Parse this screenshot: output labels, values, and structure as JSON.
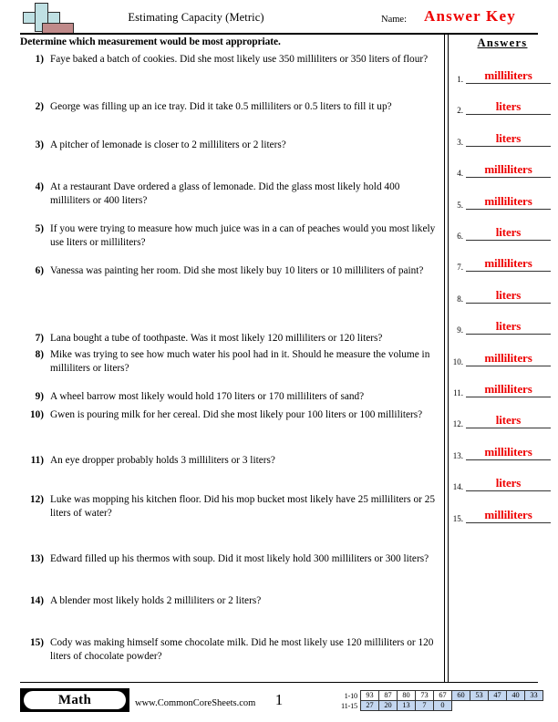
{
  "header": {
    "title": "Estimating Capacity (Metric)",
    "name_label": "Name:",
    "answer_key_label": "Answer Key",
    "instructions": "Determine which measurement would be most appropriate.",
    "logo_name": "commoncoresheets-plus-logo"
  },
  "answers_column": {
    "heading": "Answers",
    "items": [
      {
        "num": "1.",
        "value": "milliliters"
      },
      {
        "num": "2.",
        "value": "liters"
      },
      {
        "num": "3.",
        "value": "liters"
      },
      {
        "num": "4.",
        "value": "milliliters"
      },
      {
        "num": "5.",
        "value": "milliliters"
      },
      {
        "num": "6.",
        "value": "liters"
      },
      {
        "num": "7.",
        "value": "milliliters"
      },
      {
        "num": "8.",
        "value": "liters"
      },
      {
        "num": "9.",
        "value": "liters"
      },
      {
        "num": "10.",
        "value": "milliliters"
      },
      {
        "num": "11.",
        "value": "milliliters"
      },
      {
        "num": "12.",
        "value": "liters"
      },
      {
        "num": "13.",
        "value": "milliliters"
      },
      {
        "num": "14.",
        "value": "liters"
      },
      {
        "num": "15.",
        "value": "milliliters"
      }
    ]
  },
  "questions": [
    {
      "num": "1)",
      "text": "Faye baked a batch of cookies. Did she most likely use 350 milliliters or 350 liters of flour?"
    },
    {
      "num": "2)",
      "text": "George was filling up an ice tray. Did it take 0.5 milliliters or 0.5 liters to fill it up?"
    },
    {
      "num": "3)",
      "text": "A pitcher of lemonade is closer to 2 milliliters or 2 liters?"
    },
    {
      "num": "4)",
      "text": "At a restaurant Dave ordered a glass of lemonade. Did the glass most likely hold 400 milliliters or 400 liters?"
    },
    {
      "num": "5)",
      "text": "If you were trying to measure how much juice was in a can of peaches would you most likely use liters or milliliters?"
    },
    {
      "num": "6)",
      "text": "Vanessa was painting her room. Did she most likely buy 10 liters or 10 milliliters of paint?"
    },
    {
      "num": "7)",
      "text": "Lana bought a tube of toothpaste. Was it most likely 120 milliliters or 120 liters?"
    },
    {
      "num": "8)",
      "text": "Mike was trying to see how much water his pool had in it. Should he measure the volume in milliliters or liters?"
    },
    {
      "num": "9)",
      "text": "A wheel barrow most likely would hold 170 liters or 170 milliliters of sand?"
    },
    {
      "num": "10)",
      "text": "Gwen is pouring milk for her cereal. Did she most likely pour 100 liters or 100 milliliters?"
    },
    {
      "num": "11)",
      "text": "An eye dropper probably holds 3 milliliters or 3 liters?"
    },
    {
      "num": "12)",
      "text": "Luke was mopping his kitchen floor. Did his mop bucket most likely have 25 milliliters or 25 liters of water?"
    },
    {
      "num": "13)",
      "text": "Edward filled up his thermos with soup. Did it most likely hold 300 milliliters or 300 liters?"
    },
    {
      "num": "14)",
      "text": "A blender most likely holds 2 milliliters or 2 liters?"
    },
    {
      "num": "15)",
      "text": "Cody was making himself some chocolate milk. Did he most likely use 120 milliliters or 120 liters of chocolate powder?"
    }
  ],
  "footer": {
    "subject_badge": "Math",
    "website": "www.CommonCoreSheets.com",
    "page_number": "1",
    "score_table": {
      "row1_label": "1-10",
      "row2_label": "11-15",
      "row1": [
        "93",
        "87",
        "80",
        "73",
        "67",
        "60",
        "53",
        "47",
        "40",
        "33"
      ],
      "row2": [
        "27",
        "20",
        "13",
        "7",
        "0"
      ],
      "row1_blue_start_index": 5,
      "blue_color": "#c4d7f0"
    }
  },
  "colors": {
    "answer_red": "#ee0000",
    "logo_blue": "#bfe0e3",
    "logo_red": "#c08a8a",
    "rule_black": "#000000"
  }
}
